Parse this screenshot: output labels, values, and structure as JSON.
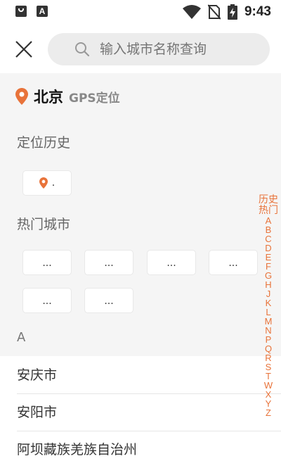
{
  "status": {
    "time": "9:43",
    "left_icons": [
      "app-notification-icon",
      "accessibility-a-icon"
    ],
    "right_icons": [
      "wifi-icon",
      "no-sim-icon",
      "battery-charging-icon"
    ]
  },
  "header": {
    "close_icon": "close-icon",
    "search_icon": "search-icon",
    "search_placeholder": "输入城市名称查询"
  },
  "location": {
    "city": "北京",
    "gps_label": "GPS定位",
    "accent": "#e8733a"
  },
  "history": {
    "title": "定位历史",
    "items": [
      "."
    ]
  },
  "hot": {
    "title": "热门城市",
    "items": [
      "...",
      "...",
      "...",
      "...",
      "...",
      "..."
    ]
  },
  "list": {
    "letter": "A",
    "cities": [
      "安庆市",
      "安阳市",
      "阿坝藏族羌族自治州"
    ]
  },
  "index_bar": {
    "top_labels": [
      "历史",
      "热门"
    ],
    "letters": [
      "A",
      "B",
      "C",
      "D",
      "E",
      "F",
      "G",
      "H",
      "J",
      "K",
      "L",
      "M",
      "N",
      "P",
      "Q",
      "R",
      "S",
      "T",
      "W",
      "X",
      "Y",
      "Z"
    ]
  }
}
